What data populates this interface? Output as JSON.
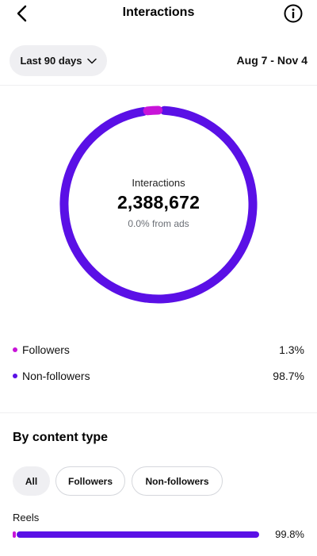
{
  "header": {
    "title": "Interactions"
  },
  "filters": {
    "range_label": "Last 90 days",
    "date_range": "Aug 7 - Nov 4"
  },
  "summary": {
    "label": "Interactions",
    "value": "2,388,672",
    "sub": "0.0% from ads"
  },
  "colors": {
    "followers": "#c814d8",
    "non_followers": "#5a10e6"
  },
  "audience": [
    {
      "label": "Followers",
      "value": "1.3%",
      "share": 0.013,
      "color": "#c814d8"
    },
    {
      "label": "Non-followers",
      "value": "98.7%",
      "share": 0.987,
      "color": "#5a10e6"
    }
  ],
  "content_type": {
    "title": "By content type",
    "chips": [
      "All",
      "Followers",
      "Non-followers"
    ],
    "rows": [
      {
        "label": "Reels",
        "value": "99.8%",
        "followers_share": 0.013,
        "non_followers_share": 0.987,
        "total": 0.998
      }
    ]
  },
  "icons": {
    "back": "chevron-left-icon",
    "info": "info-icon",
    "dropdown": "chevron-down-icon"
  }
}
